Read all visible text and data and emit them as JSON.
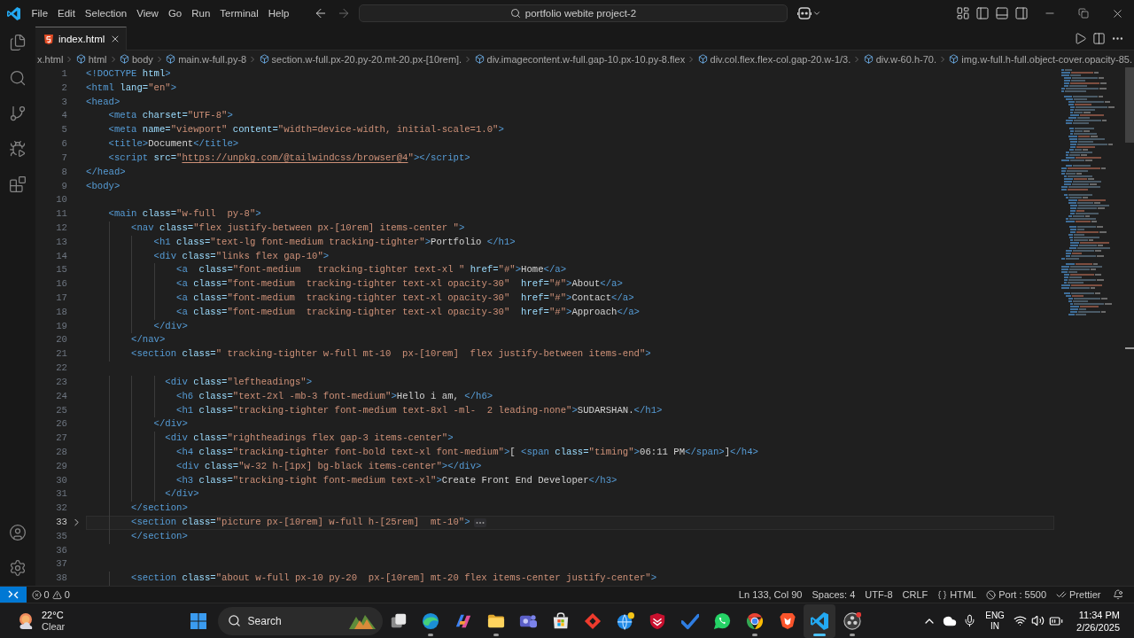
{
  "title_bar": {
    "menu": [
      "File",
      "Edit",
      "Selection",
      "View",
      "Go",
      "Run",
      "Terminal",
      "Help"
    ],
    "command_center": "portfolio webite project-2"
  },
  "tabs": [
    {
      "label": "index.html",
      "selected": true
    }
  ],
  "breadcrumbs": [
    "x.html",
    "html",
    "body",
    "main.w-full.py-8",
    "section.w-full.px-20.py-20.mt-20.px-[10rem].",
    "div.imagecontent.w-full.gap-10.px-10.py-8.flex",
    "div.col.flex.flex-col.gap-20.w-1/3.",
    "div.w-60.h-70.",
    "img.w-full.h-full.object-cover.opacity-85."
  ],
  "editor": {
    "lines": [
      {
        "number": "1",
        "folded": false,
        "current": false,
        "segments": [
          {
            "kind": "tag",
            "text": "<!DOCTYPE"
          },
          {
            "kind": "attr",
            "text": " html"
          },
          {
            "kind": "tag",
            "text": ">"
          }
        ]
      },
      {
        "number": "2",
        "folded": false,
        "current": false,
        "segments": [
          {
            "kind": "tag",
            "text": "<html"
          },
          {
            "kind": "attr",
            "text": " lang="
          },
          {
            "kind": "string",
            "text": "\"en\""
          },
          {
            "kind": "tag",
            "text": ">"
          }
        ]
      },
      {
        "number": "3",
        "folded": false,
        "current": false,
        "segments": [
          {
            "kind": "tag",
            "text": "<head>"
          }
        ]
      },
      {
        "number": "4",
        "folded": false,
        "current": false,
        "segments": [
          {
            "kind": "tag",
            "text": "    <meta"
          },
          {
            "kind": "attr",
            "text": " charset="
          },
          {
            "kind": "string",
            "text": "\"UTF-8\""
          },
          {
            "kind": "tag",
            "text": ">"
          }
        ]
      },
      {
        "number": "5",
        "folded": false,
        "current": false,
        "segments": [
          {
            "kind": "tag",
            "text": "    <meta"
          },
          {
            "kind": "attr",
            "text": " name="
          },
          {
            "kind": "string",
            "text": "\"viewport\""
          },
          {
            "kind": "attr",
            "text": " content="
          },
          {
            "kind": "string",
            "text": "\"width=device-width, initial-scale=1.0\""
          },
          {
            "kind": "tag",
            "text": ">"
          }
        ]
      },
      {
        "number": "6",
        "folded": false,
        "current": false,
        "segments": [
          {
            "kind": "tag",
            "text": "    <title>"
          },
          {
            "kind": "text",
            "text": "Document"
          },
          {
            "kind": "tag",
            "text": "</title>"
          }
        ]
      },
      {
        "number": "7",
        "folded": false,
        "current": false,
        "segments": [
          {
            "kind": "tag",
            "text": "    <script"
          },
          {
            "kind": "attr",
            "text": " src="
          },
          {
            "kind": "string",
            "text": "\""
          },
          {
            "kind": "link",
            "text": "https://unpkg.com/@tailwindcss/browser@4"
          },
          {
            "kind": "string",
            "text": "\""
          },
          {
            "kind": "tag",
            "text": "></script>"
          }
        ]
      },
      {
        "number": "8",
        "folded": false,
        "current": false,
        "segments": [
          {
            "kind": "tag",
            "text": "</head>"
          }
        ]
      },
      {
        "number": "9",
        "folded": false,
        "current": false,
        "segments": [
          {
            "kind": "tag",
            "text": "<body>"
          }
        ]
      },
      {
        "number": "10",
        "folded": false,
        "current": false
      },
      {
        "number": "11",
        "folded": false,
        "current": false,
        "segments": [
          {
            "kind": "tag",
            "text": "    <main"
          },
          {
            "kind": "attr",
            "text": " class="
          },
          {
            "kind": "string",
            "text": "\"w-full  py-8\""
          },
          {
            "kind": "tag",
            "text": ">"
          }
        ]
      },
      {
        "number": "12",
        "folded": false,
        "current": false,
        "segments": [
          {
            "kind": "tag",
            "text": "        <nav"
          },
          {
            "kind": "attr",
            "text": " class="
          },
          {
            "kind": "string",
            "text": "\"flex justify-between px-[10rem] items-center \""
          },
          {
            "kind": "tag",
            "text": ">"
          }
        ]
      },
      {
        "number": "13",
        "folded": false,
        "current": false,
        "segments": [
          {
            "kind": "tag",
            "text": "            <h1"
          },
          {
            "kind": "attr",
            "text": " class="
          },
          {
            "kind": "string",
            "text": "\"text-lg font-medium tracking-tighter\""
          },
          {
            "kind": "tag",
            "text": ">"
          },
          {
            "kind": "text",
            "text": "Portfolio "
          },
          {
            "kind": "tag",
            "text": "</h1>"
          }
        ]
      },
      {
        "number": "14",
        "folded": false,
        "current": false,
        "segments": [
          {
            "kind": "tag",
            "text": "            <div"
          },
          {
            "kind": "attr",
            "text": " class="
          },
          {
            "kind": "string",
            "text": "\"links flex gap-10\""
          },
          {
            "kind": "tag",
            "text": ">"
          }
        ]
      },
      {
        "number": "15",
        "folded": false,
        "current": false,
        "segments": [
          {
            "kind": "tag",
            "text": "                <a"
          },
          {
            "kind": "attr",
            "text": "  class="
          },
          {
            "kind": "string",
            "text": "\"font-medium   tracking-tighter text-xl \""
          },
          {
            "kind": "attr",
            "text": " href="
          },
          {
            "kind": "string",
            "text": "\"#\""
          },
          {
            "kind": "tag",
            "text": ">"
          },
          {
            "kind": "text",
            "text": "Home"
          },
          {
            "kind": "tag",
            "text": "</a>"
          }
        ]
      },
      {
        "number": "16",
        "folded": false,
        "current": false,
        "segments": [
          {
            "kind": "tag",
            "text": "                <a"
          },
          {
            "kind": "attr",
            "text": " class="
          },
          {
            "kind": "string",
            "text": "\"font-medium  tracking-tighter text-xl opacity-30\""
          },
          {
            "kind": "attr",
            "text": "  href="
          },
          {
            "kind": "string",
            "text": "\"#\""
          },
          {
            "kind": "tag",
            "text": ">"
          },
          {
            "kind": "text",
            "text": "About"
          },
          {
            "kind": "tag",
            "text": "</a>"
          }
        ]
      },
      {
        "number": "17",
        "folded": false,
        "current": false,
        "segments": [
          {
            "kind": "tag",
            "text": "                <a"
          },
          {
            "kind": "attr",
            "text": " class="
          },
          {
            "kind": "string",
            "text": "\"font-medium  tracking-tighter text-xl opacity-30\""
          },
          {
            "kind": "attr",
            "text": "  href="
          },
          {
            "kind": "string",
            "text": "\"#\""
          },
          {
            "kind": "tag",
            "text": ">"
          },
          {
            "kind": "text",
            "text": "Contact"
          },
          {
            "kind": "tag",
            "text": "</a>"
          }
        ]
      },
      {
        "number": "18",
        "folded": false,
        "current": false,
        "segments": [
          {
            "kind": "tag",
            "text": "                <a"
          },
          {
            "kind": "attr",
            "text": " class="
          },
          {
            "kind": "string",
            "text": "\"font-medium  tracking-tighter text-xl opacity-30\""
          },
          {
            "kind": "attr",
            "text": "  href="
          },
          {
            "kind": "string",
            "text": "\"#\""
          },
          {
            "kind": "tag",
            "text": ">"
          },
          {
            "kind": "text",
            "text": "Approach"
          },
          {
            "kind": "tag",
            "text": "</a>"
          }
        ]
      },
      {
        "number": "19",
        "folded": false,
        "current": false,
        "segments": [
          {
            "kind": "tag",
            "text": "            </div>"
          }
        ]
      },
      {
        "number": "20",
        "folded": false,
        "current": false,
        "segments": [
          {
            "kind": "tag",
            "text": "        </nav>"
          }
        ]
      },
      {
        "number": "21",
        "folded": false,
        "current": false,
        "segments": [
          {
            "kind": "tag",
            "text": "        <section"
          },
          {
            "kind": "attr",
            "text": " class="
          },
          {
            "kind": "string",
            "text": "\" tracking-tighter w-full mt-10  px-[10rem]  flex justify-between items-end\""
          },
          {
            "kind": "tag",
            "text": ">"
          }
        ]
      },
      {
        "number": "22",
        "folded": false,
        "current": false
      },
      {
        "number": "23",
        "folded": false,
        "current": false,
        "segments": [
          {
            "kind": "tag",
            "text": "              <div"
          },
          {
            "kind": "attr",
            "text": " class="
          },
          {
            "kind": "string",
            "text": "\"leftheadings\""
          },
          {
            "kind": "tag",
            "text": ">"
          }
        ]
      },
      {
        "number": "24",
        "folded": false,
        "current": false,
        "segments": [
          {
            "kind": "tag",
            "text": "                <h6"
          },
          {
            "kind": "attr",
            "text": " class="
          },
          {
            "kind": "string",
            "text": "\"text-2xl -mb-3 font-medium\""
          },
          {
            "kind": "tag",
            "text": ">"
          },
          {
            "kind": "text",
            "text": "Hello i am, "
          },
          {
            "kind": "tag",
            "text": "</h6>"
          }
        ]
      },
      {
        "number": "25",
        "folded": false,
        "current": false,
        "segments": [
          {
            "kind": "tag",
            "text": "                <h1"
          },
          {
            "kind": "attr",
            "text": " class="
          },
          {
            "kind": "string",
            "text": "\"tracking-tighter font-medium text-8xl -ml-  2 leading-none\""
          },
          {
            "kind": "tag",
            "text": ">"
          },
          {
            "kind": "text",
            "text": "SUDARSHAN."
          },
          {
            "kind": "tag",
            "text": "</h1>"
          }
        ]
      },
      {
        "number": "26",
        "folded": false,
        "current": false,
        "segments": [
          {
            "kind": "tag",
            "text": "            </div>"
          }
        ]
      },
      {
        "number": "27",
        "folded": false,
        "current": false,
        "segments": [
          {
            "kind": "tag",
            "text": "              <div"
          },
          {
            "kind": "attr",
            "text": " class="
          },
          {
            "kind": "string",
            "text": "\"rightheadings flex gap-3 items-center\""
          },
          {
            "kind": "tag",
            "text": ">"
          }
        ]
      },
      {
        "number": "28",
        "folded": false,
        "current": false,
        "segments": [
          {
            "kind": "tag",
            "text": "                <h4"
          },
          {
            "kind": "attr",
            "text": " class="
          },
          {
            "kind": "string",
            "text": "\"tracking-tighter font-bold text-xl font-medium\""
          },
          {
            "kind": "tag",
            "text": ">"
          },
          {
            "kind": "text",
            "text": "[ "
          },
          {
            "kind": "tag",
            "text": "<span"
          },
          {
            "kind": "attr",
            "text": " class="
          },
          {
            "kind": "string",
            "text": "\"timing\""
          },
          {
            "kind": "tag",
            "text": ">"
          },
          {
            "kind": "text",
            "text": "06:11 PM"
          },
          {
            "kind": "tag",
            "text": "</span>"
          },
          {
            "kind": "text",
            "text": "]"
          },
          {
            "kind": "tag",
            "text": "</h4>"
          }
        ]
      },
      {
        "number": "29",
        "folded": false,
        "current": false,
        "segments": [
          {
            "kind": "tag",
            "text": "                <div"
          },
          {
            "kind": "attr",
            "text": " class="
          },
          {
            "kind": "string",
            "text": "\"w-32 h-[1px] bg-black items-center\""
          },
          {
            "kind": "tag",
            "text": "></div>"
          }
        ]
      },
      {
        "number": "30",
        "folded": false,
        "current": false,
        "segments": [
          {
            "kind": "tag",
            "text": "                <h3"
          },
          {
            "kind": "attr",
            "text": " class="
          },
          {
            "kind": "string",
            "text": "\"tracking-tight font-medium text-xl\""
          },
          {
            "kind": "tag",
            "text": ">"
          },
          {
            "kind": "text",
            "text": "Create Front End Developer"
          },
          {
            "kind": "tag",
            "text": "</h3>"
          }
        ]
      },
      {
        "number": "31",
        "folded": false,
        "current": false,
        "segments": [
          {
            "kind": "tag",
            "text": "              </div>"
          }
        ]
      },
      {
        "number": "32",
        "folded": false,
        "current": false,
        "segments": [
          {
            "kind": "tag",
            "text": "        </section>"
          }
        ]
      },
      {
        "number": "33",
        "folded": true,
        "current": true,
        "segments": [
          {
            "kind": "tag",
            "text": "        <section"
          },
          {
            "kind": "attr",
            "text": " class="
          },
          {
            "kind": "string",
            "text": "\"picture px-[10rem] w-full h-[25rem]  mt-10\""
          },
          {
            "kind": "tag",
            "text": ">"
          }
        ]
      },
      {
        "number": "35",
        "folded": false,
        "current": false,
        "segments": [
          {
            "kind": "tag",
            "text": "        </section>"
          }
        ]
      },
      {
        "number": "36",
        "folded": false,
        "current": false
      },
      {
        "number": "37",
        "folded": false,
        "current": false
      },
      {
        "number": "38",
        "folded": false,
        "current": false,
        "segments": [
          {
            "kind": "tag",
            "text": "        <section"
          },
          {
            "kind": "attr",
            "text": " class="
          },
          {
            "kind": "string",
            "text": "\"about w-full px-10 py-20  px-[10rem] mt-20 flex items-center justify-center\""
          },
          {
            "kind": "tag",
            "text": ">"
          }
        ]
      }
    ]
  },
  "status_bar": {
    "errors": "0",
    "warnings": "0",
    "items": [
      {
        "kind": "position",
        "label": "Ln 133, Col 90"
      },
      {
        "kind": "indent",
        "label": "Spaces: 4"
      },
      {
        "kind": "encoding",
        "label": "UTF-8"
      },
      {
        "kind": "eol",
        "label": "CRLF"
      },
      {
        "kind": "language",
        "label": "HTML"
      },
      {
        "kind": "port",
        "label": "Port : 5500"
      },
      {
        "kind": "formatter",
        "label": "Prettier"
      }
    ]
  },
  "taskbar": {
    "weather": {
      "temperature": "22°C",
      "condition": "Clear"
    },
    "search": {
      "label": "Search"
    },
    "apps": [
      {
        "kind": "squares",
        "running": false,
        "selected": false
      },
      {
        "kind": "wave",
        "running": true,
        "selected": false
      },
      {
        "kind": "ribbon",
        "running": false,
        "selected": false
      },
      {
        "kind": "folder",
        "running": true,
        "selected": false
      },
      {
        "kind": "people",
        "running": false,
        "selected": false
      },
      {
        "kind": "bag",
        "running": false,
        "selected": false
      },
      {
        "kind": "diamond",
        "running": false,
        "selected": false
      },
      {
        "kind": "orb",
        "running": false,
        "selected": false
      },
      {
        "kind": "shield",
        "running": false,
        "selected": false
      },
      {
        "kind": "check",
        "running": false,
        "selected": false
      },
      {
        "kind": "bubble",
        "running": false,
        "selected": false
      },
      {
        "kind": "wheel",
        "running": true,
        "selected": false
      },
      {
        "kind": "crest",
        "running": false,
        "selected": false
      },
      {
        "kind": "code",
        "running": true,
        "selected": true
      },
      {
        "kind": "record",
        "running": true,
        "selected": false
      }
    ],
    "tray": {
      "language": "ENG",
      "region": "IN",
      "time": "11:34 PM",
      "date": "2/26/2025"
    }
  }
}
